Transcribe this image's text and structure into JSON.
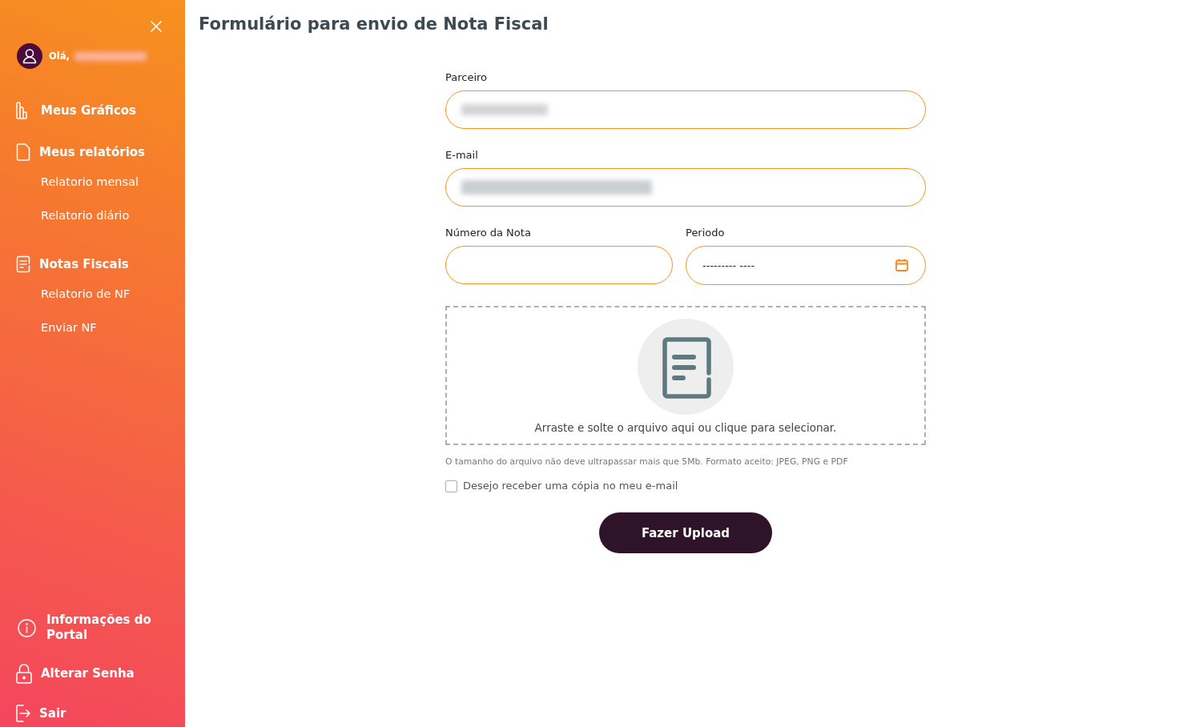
{
  "sidebar": {
    "greeting": "Olá,",
    "user_name_blurred": true,
    "nav": [
      {
        "label": "Meus Gráficos"
      },
      {
        "label": "Meus relatórios",
        "children": [
          {
            "label": "Relatorio mensal"
          },
          {
            "label": "Relatorio diário"
          }
        ]
      },
      {
        "label": "Notas Fiscais",
        "children": [
          {
            "label": "Relatorio de NF"
          },
          {
            "label": "Enviar NF"
          }
        ]
      }
    ],
    "footer_nav": [
      {
        "label": "Informações do Portal"
      },
      {
        "label": "Alterar Senha"
      },
      {
        "label": "Sair"
      }
    ]
  },
  "page": {
    "title": "Formulário para envio de Nota Fiscal"
  },
  "form": {
    "rows": [
      {
        "fields": [
          {
            "kind": "text",
            "label": "Parceiro",
            "value_blurred": true
          }
        ]
      },
      {
        "fields": [
          {
            "kind": "text",
            "label": "E-mail",
            "value_blurred": true
          }
        ]
      },
      {
        "fields": [
          {
            "kind": "text",
            "label": "Número da Nota",
            "value_blurred": false
          },
          {
            "kind": "month",
            "label": "Periodo",
            "placeholder": "--------- ----",
            "value_blurred": false
          }
        ]
      }
    ],
    "dropzone": {
      "text": "Arraste e solte o arquivo aqui ou clique para selecionar."
    },
    "hint": "O tamanho do arquivo não deve ultrapassar mais que 5Mb. Formato aceito: JPEG, PNG e PDF",
    "copy_checkbox": {
      "label": "Desejo receber uma cópia no meu e-mail",
      "checked": false
    },
    "submit": "Fazer Upload"
  }
}
